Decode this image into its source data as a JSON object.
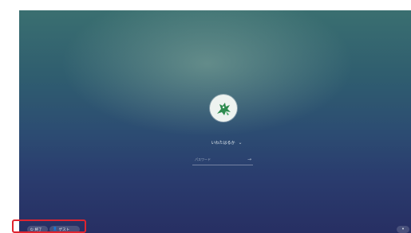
{
  "login": {
    "user_name": "いわたはるか",
    "password_placeholder": "パスワード"
  },
  "shelf": {
    "shutdown_label": "終了",
    "guest_label": "ゲスト"
  },
  "colors": {
    "highlight": "#e0242f",
    "avatar_bg": "#eef3f0",
    "dragon": "#2e8b4f"
  },
  "icons": {
    "shutdown": "power-icon",
    "guest": "person-icon",
    "status": "status-icon",
    "user_menu": "chevron-down-icon",
    "submit": "arrow-right-icon"
  }
}
